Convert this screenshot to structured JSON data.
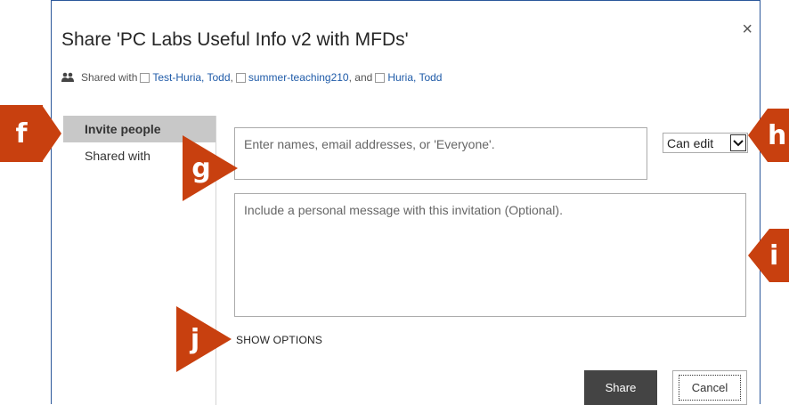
{
  "dialog": {
    "title": "Share 'PC Labs Useful Info v2 with MFDs'",
    "close_glyph": "×",
    "shared_with_prefix": "Shared with",
    "shared_users": [
      "Test-Huria, Todd",
      "summer-teaching210",
      "Huria, Todd"
    ],
    "sep_comma": ",",
    "sep_and": ", and"
  },
  "sidenav": {
    "items": [
      {
        "label": "Invite people",
        "active": true
      },
      {
        "label": "Shared with",
        "active": false
      }
    ]
  },
  "invite": {
    "names_placeholder": "Enter names, email addresses, or 'Everyone'.",
    "permission_value": "Can edit",
    "message_placeholder": "Include a personal message with this invitation (Optional).",
    "show_options": "SHOW OPTIONS",
    "share_button": "Share",
    "cancel_button": "Cancel"
  },
  "callouts": [
    "f",
    "g",
    "h",
    "i",
    "j"
  ],
  "colors": {
    "accent": "#2b579a",
    "callout": "#c8400f",
    "link": "#1f5ba8",
    "share_button": "#444444"
  }
}
